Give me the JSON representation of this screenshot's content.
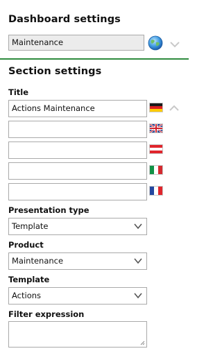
{
  "dashboard": {
    "title": "Dashboard settings",
    "selected": "Maintenance"
  },
  "section": {
    "title": "Section settings",
    "title_label": "Title",
    "title_values": {
      "german": "Actions Maintenance",
      "english": "",
      "austrian": "",
      "italian": "",
      "french": ""
    },
    "presentation_type_label": "Presentation type",
    "presentation_type_value": "Template",
    "product_label": "Product",
    "product_value": "Maintenance",
    "template_label": "Template",
    "template_value": "Actions",
    "filter_label": "Filter expression",
    "filter_value": ""
  },
  "colors": {
    "divider": "#2e8b3e",
    "select_bg": "#ececec"
  },
  "icons": [
    "globe-icon",
    "chevron-down-icon",
    "chevron-up-icon",
    "flag-de-icon",
    "flag-uk-icon",
    "flag-at-icon",
    "flag-it-icon",
    "flag-fr-icon"
  ]
}
